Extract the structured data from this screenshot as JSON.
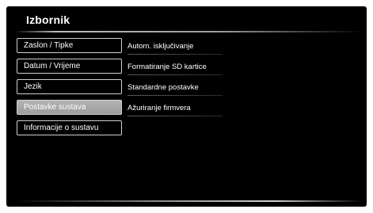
{
  "header": {
    "title": "Izbornik"
  },
  "menu": {
    "items": [
      {
        "label": "Zaslon / Tipke"
      },
      {
        "label": "Datum / Vrijeme"
      },
      {
        "label": "Jezik"
      },
      {
        "label": "Postavke sustava"
      },
      {
        "label": "Informacije o sustavu"
      }
    ],
    "selected": "Postavke sustava"
  },
  "submenu": {
    "items": [
      {
        "label": "Autom. isključivanje"
      },
      {
        "label": "Formatiranje SD kartice"
      },
      {
        "label": "Standardne postavke"
      },
      {
        "label": "Ažuriranje firmvera"
      }
    ]
  },
  "colors": {
    "background": "#000000",
    "text": "#ffffff",
    "border": "#cfcfcf",
    "selected": "#a8a8a8"
  }
}
